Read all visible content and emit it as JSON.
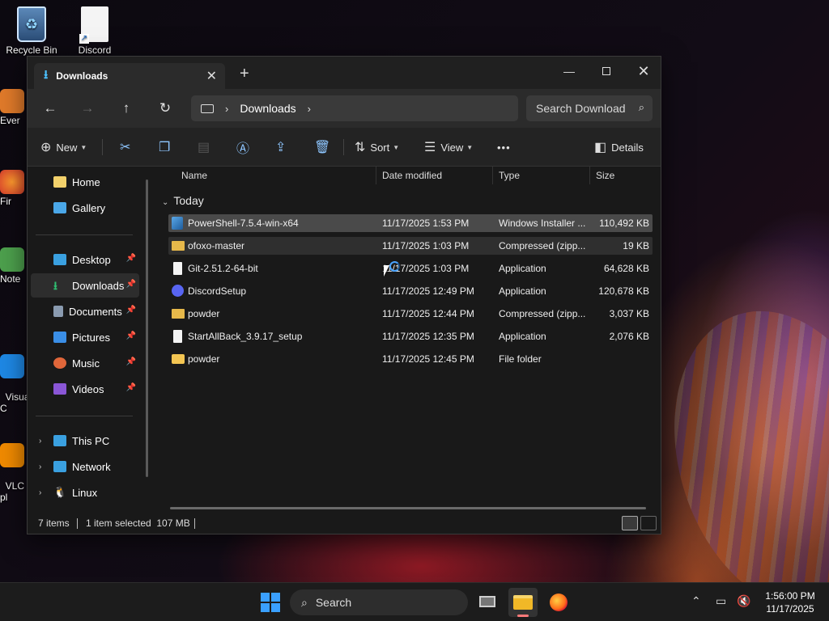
{
  "desktop": {
    "icons": [
      {
        "label": "Recycle Bin"
      },
      {
        "label": "Discord"
      }
    ],
    "side_labels": [
      "Ever",
      "Fir",
      "Note",
      "Visua\nC",
      "VLC\npl"
    ]
  },
  "window": {
    "tab_title": "Downloads",
    "tab_close": "✕",
    "new_tab": "+",
    "controls": {
      "minimize": "—",
      "close": "✕"
    }
  },
  "address": {
    "crumbs": [
      "Downloads"
    ],
    "search_placeholder": "Search Downloads"
  },
  "commands": {
    "new": "New",
    "sort": "Sort",
    "view": "View",
    "more": "•••",
    "details": "Details"
  },
  "nav": {
    "quick": [
      {
        "label": "Home"
      },
      {
        "label": "Gallery"
      }
    ],
    "pinned": [
      {
        "label": "Desktop",
        "color": "#3aa0e0"
      },
      {
        "label": "Downloads",
        "color": "#2fbf71"
      },
      {
        "label": "Documents",
        "color": "#8a9bb0"
      },
      {
        "label": "Pictures",
        "color": "#3a8ee6"
      },
      {
        "label": "Music",
        "color": "#e0663a"
      },
      {
        "label": "Videos",
        "color": "#8a56d6"
      }
    ],
    "places": [
      {
        "label": "This PC"
      },
      {
        "label": "Network"
      },
      {
        "label": "Linux"
      }
    ]
  },
  "columns": {
    "name": "Name",
    "date": "Date modified",
    "type": "Type",
    "size": "Size"
  },
  "group_label": "Today",
  "files": [
    {
      "name": "PowerShell-7.5.4-win-x64",
      "date": "11/17/2025 1:53 PM",
      "type": "Windows Installer ...",
      "size": "110,492 KB",
      "icon": "msi-icon",
      "state": "selected"
    },
    {
      "name": "ofoxo-master",
      "date": "11/17/2025 1:03 PM",
      "type": "Compressed (zipp...",
      "size": "19 KB",
      "icon": "zip-folder-icon",
      "state": "hover"
    },
    {
      "name": "Git-2.51.2-64-bit",
      "date": "11/17/2025 1:03 PM",
      "type": "Application",
      "size": "64,628 KB",
      "icon": "application-icon",
      "state": ""
    },
    {
      "name": "DiscordSetup",
      "date": "11/17/2025 12:49 PM",
      "type": "Application",
      "size": "120,678 KB",
      "icon": "discord-icon",
      "state": ""
    },
    {
      "name": "powder",
      "date": "11/17/2025 12:44 PM",
      "type": "Compressed (zipp...",
      "size": "3,037 KB",
      "icon": "zip-folder-icon",
      "state": ""
    },
    {
      "name": "StartAllBack_3.9.17_setup",
      "date": "11/17/2025 12:35 PM",
      "type": "Application",
      "size": "2,076 KB",
      "icon": "application-icon",
      "state": ""
    },
    {
      "name": "powder",
      "date": "11/17/2025 12:45 PM",
      "type": "File folder",
      "size": "",
      "icon": "folder-icon",
      "state": ""
    }
  ],
  "status": {
    "count": "7 items",
    "selection": "1 item selected  107 MB"
  },
  "taskbar": {
    "search_label": "Search",
    "time": "1:56:00 PM",
    "date": "11/17/2025"
  }
}
